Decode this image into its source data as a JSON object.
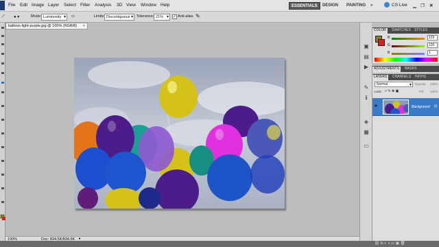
{
  "menu": [
    "File",
    "Edit",
    "Image",
    "Layer",
    "Select",
    "Filter",
    "Analysis",
    "3D",
    "View",
    "Window",
    "Help"
  ],
  "workspaces": [
    "ESSENTIALS",
    "DESIGN",
    "PAINTING"
  ],
  "cs_live": "CS Live",
  "options": {
    "mode_label": "Mode:",
    "mode_value": "Luminosity",
    "limits_label": "Limits:",
    "limits_value": "Discontiguous",
    "tolerance_label": "Tolerance:",
    "tolerance_value": "21%",
    "antialias_label": "Anti-alias",
    "antialias_checked": true
  },
  "doc_tab": "balloon-light-purple.jpg @ 100% (RGB/8)",
  "status": {
    "zoom": "100%",
    "doc": "Doc: 834.5K/834.5K"
  },
  "color_panel": {
    "tabs": [
      "COLOR",
      "SWATCHES",
      "STYLES"
    ],
    "r_label": "R",
    "g_label": "G",
    "b_label": "B",
    "r_value": "133",
    "g_value": "126",
    "b_value": "1",
    "fg": "#85801a",
    "bg": "#d42020"
  },
  "adjust_tabs": [
    "ADJUSTMENTS",
    "MASKS"
  ],
  "layers_panel": {
    "tabs": [
      "LAYERS",
      "CHANNELS",
      "PATHS"
    ],
    "blend": "Normal",
    "opacity_label": "Opacity:",
    "opacity_value": "100%",
    "lock_label": "Lock:",
    "fill_label": "Fill:",
    "fill_value": "100%",
    "layer_name": "Background"
  }
}
